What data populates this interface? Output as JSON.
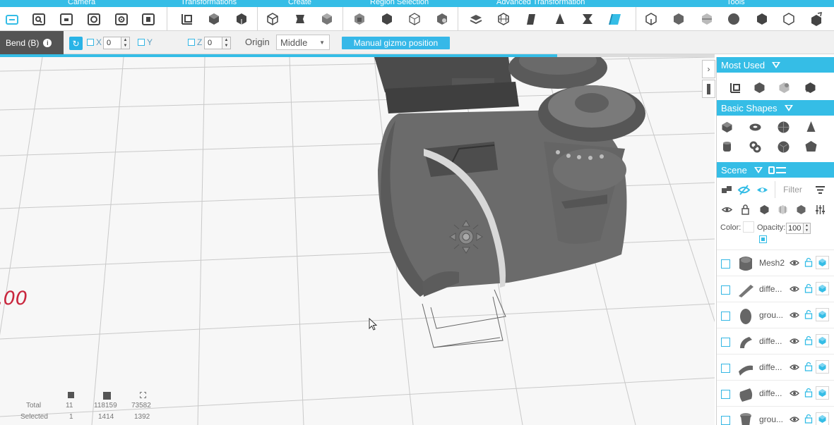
{
  "ribbon": {
    "groups": [
      {
        "title": "Camera"
      },
      {
        "title": "Transformations"
      },
      {
        "title": "Create"
      },
      {
        "title": "Region Selection"
      },
      {
        "title": "Advanced Transformation"
      },
      {
        "title": "Tools"
      }
    ]
  },
  "options": {
    "tool_label": "Bend (B)",
    "info_icon": "i",
    "x_label": "X",
    "x_value": "0",
    "y_label": "Y",
    "z_label": "Z",
    "z_value": "0",
    "origin_label": "Origin",
    "origin_value": "Middle",
    "gizmo_button": "Manual gizmo position",
    "progress_fraction": 0.78
  },
  "viewport": {
    "overlay_number": ".00",
    "stats": {
      "total_label": "Total",
      "selected_label": "Selected",
      "total_objects": "11",
      "total_vertices": "118159",
      "total_faces": "73582",
      "selected_objects": "1",
      "selected_vertices": "1414",
      "selected_faces": "1392"
    }
  },
  "panel": {
    "most_used_title": "Most Used",
    "basic_shapes_title": "Basic Shapes",
    "scene_title": "Scene",
    "filter_placeholder": "Filter",
    "color_label": "Color:",
    "opacity_label": "Opacity:",
    "opacity_value": "100",
    "objects": [
      {
        "name": "Mesh2"
      },
      {
        "name": "diffe..."
      },
      {
        "name": "grou..."
      },
      {
        "name": "diffe..."
      },
      {
        "name": "diffe..."
      },
      {
        "name": "diffe..."
      },
      {
        "name": "grou..."
      }
    ]
  },
  "colors": {
    "accent": "#35bde6",
    "tool_label_bg": "#545454",
    "overlay_number": "#c9273e"
  }
}
